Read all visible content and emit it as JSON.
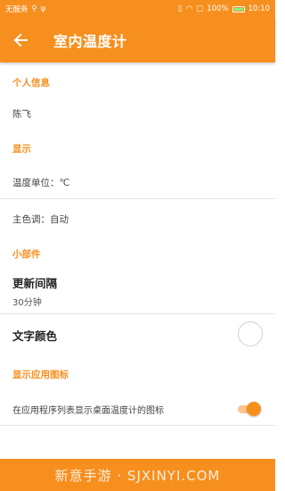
{
  "status_bar": {
    "carrier": "无服务",
    "battery": "100%",
    "time": "10:10",
    "colors": {
      "background": "#f78f1e"
    }
  },
  "app_bar": {
    "title": "室内温度计",
    "back_icon": "arrow-left-icon",
    "colors": {
      "background": "#f78f1e",
      "text": "#ffffff"
    }
  },
  "sections": {
    "personal": {
      "header": "个人信息",
      "name": "陈飞"
    },
    "display": {
      "header": "显示",
      "temperature_unit": "温度单位：℃",
      "theme_color": "主色调：自动"
    },
    "widget": {
      "header": "小部件",
      "update_interval_title": "更新间隔",
      "update_interval_value": "30分钟",
      "text_color_title": "文字颜色"
    },
    "app_icon": {
      "header": "显示应用图标",
      "show_icon_label": "在应用程序列表显示桌面温度计的图标",
      "show_icon_enabled": true
    }
  },
  "watermark": "新意手游 · SJXINYI.COM",
  "accent_color": "#f78f1e"
}
